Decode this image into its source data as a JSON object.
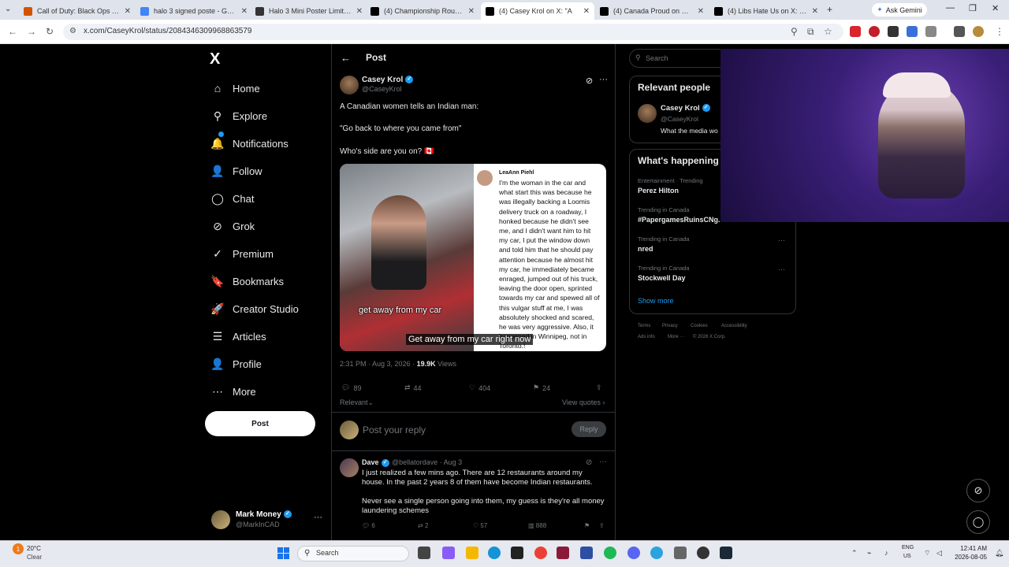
{
  "browser": {
    "tabs": [
      {
        "label": "Call of Duty: Black Ops (201",
        "favicon": "cod-icon",
        "color": "#d35400"
      },
      {
        "label": "halo 3 signed poste - Goog",
        "favicon": "google-icon",
        "color": "#4285f4"
      },
      {
        "label": "Halo 3 Mini Poster Limited",
        "favicon": "shop-icon",
        "color": "#333333"
      },
      {
        "label": "(4) Championship Rounds",
        "favicon": "x-icon",
        "color": "#000000"
      },
      {
        "label": "(4) Casey Krol on X: \"A",
        "favicon": "x-icon",
        "color": "#000000"
      },
      {
        "label": "(4) Canada Proud on X: \"Ch",
        "favicon": "x-icon",
        "color": "#000000"
      },
      {
        "label": "(4) Libs Hate Us on X: \"Cou",
        "favicon": "x-icon",
        "color": "#000000"
      }
    ],
    "new_tab": "+",
    "gemini_label": "Ask Gemini",
    "url": "x.com/CaseyKrol/status/2084346309968863579"
  },
  "nav": {
    "logo": "X",
    "items": [
      {
        "label": "Home",
        "icon": "home-icon",
        "glyph": "⌂"
      },
      {
        "label": "Explore",
        "icon": "search-icon",
        "glyph": "⚲"
      },
      {
        "label": "Notifications",
        "icon": "bell-icon",
        "glyph": "🔔"
      },
      {
        "label": "Follow",
        "icon": "person-add-icon",
        "glyph": "👤"
      },
      {
        "label": "Chat",
        "icon": "chat-icon",
        "glyph": "◯"
      },
      {
        "label": "Grok",
        "icon": "grok-icon",
        "glyph": "⊘"
      },
      {
        "label": "Premium",
        "icon": "premium-icon",
        "glyph": "✓"
      },
      {
        "label": "Bookmarks",
        "icon": "bookmark-icon",
        "glyph": "🔖"
      },
      {
        "label": "Creator Studio",
        "icon": "rocket-icon",
        "glyph": "🚀"
      },
      {
        "label": "Articles",
        "icon": "article-icon",
        "glyph": "☰"
      },
      {
        "label": "Profile",
        "icon": "person-icon",
        "glyph": "👤"
      },
      {
        "label": "More",
        "icon": "more-icon",
        "glyph": "⋯"
      }
    ],
    "post_button": "Post",
    "account": {
      "name": "Mark Money",
      "handle": "@MarkInCAD"
    }
  },
  "post": {
    "header_title": "Post",
    "author_name": "Casey Krol",
    "author_handle": "@CaseyKrol",
    "text1": "A Canadian women tells an Indian man:",
    "text2": "\"Go back to where you came from\"",
    "text3": "Who's side are you on? 🇨🇦",
    "media": {
      "caption1": "get away from my car",
      "caption2": "Get away from my car right now",
      "quoted_name": "LeaAnn Piehl",
      "quoted_text": "I'm the woman in the car and what start this was because he was illegally backing a Loomis delivery truck on a roadway, I honked because he didn't see me, and I didn't want him to hit my car, I put the window down and told him that he should pay attention because he almost hit my car, he immediately became enraged, jumped out of his truck, leaving the door open, sprinted towards my car and spewed all of this vulgar stuff at me, I was absolutely shocked and scared, he was very aggressive. Also, it happened in Winnipeg, not in Toronto.!"
    },
    "time": "2:31 PM · Aug 3, 2026 ·",
    "views_count": "19.9K",
    "views_label": "Views",
    "stats": {
      "replies": "89",
      "reposts": "44",
      "likes": "404",
      "bookmarks": "24"
    },
    "sort_label": "Relevant",
    "view_quotes": "View quotes",
    "reply_placeholder": "Post your reply",
    "reply_button": "Reply"
  },
  "reply": {
    "name": "Dave",
    "handle": "@bellatordave · Aug 3",
    "text1": "I just realized a few mins ago. There are 12 restaurants around my house. In the past 2 years 8 of them have become Indian restaurants.",
    "text2": "Never see a single person going into them, my guess is they're all money laundering schemes",
    "stats": {
      "replies": "6",
      "reposts": "2",
      "likes": "57",
      "views": "888"
    }
  },
  "sidebar": {
    "search_placeholder": "Search",
    "relevant_title": "Relevant people",
    "rp_name": "Casey Krol",
    "rp_handle": "@CaseyKrol",
    "rp_bio": "What the media wo",
    "happening_title": "What's happening",
    "trends": [
      {
        "context": "Entertainment · Trending",
        "name": "Perez Hilton"
      },
      {
        "context": "Trending in Canada",
        "name": "#PapergamesRuinsCNg..."
      },
      {
        "context": "Trending in Canada",
        "name": "nred"
      },
      {
        "context": "Trending in Canada",
        "name": "Stockwell Day"
      }
    ],
    "show_more": "Show more",
    "footer": [
      "Terms",
      "Privacy",
      "Cookies",
      "Accessibility",
      "Ads info",
      "More ···",
      "© 2026 X Corp."
    ]
  },
  "taskbar": {
    "temp": "20°C",
    "condition": "Clear",
    "search": "Search",
    "lang1": "ENG",
    "lang2": "US",
    "time": "12:41 AM",
    "date": "2026-08-05"
  }
}
